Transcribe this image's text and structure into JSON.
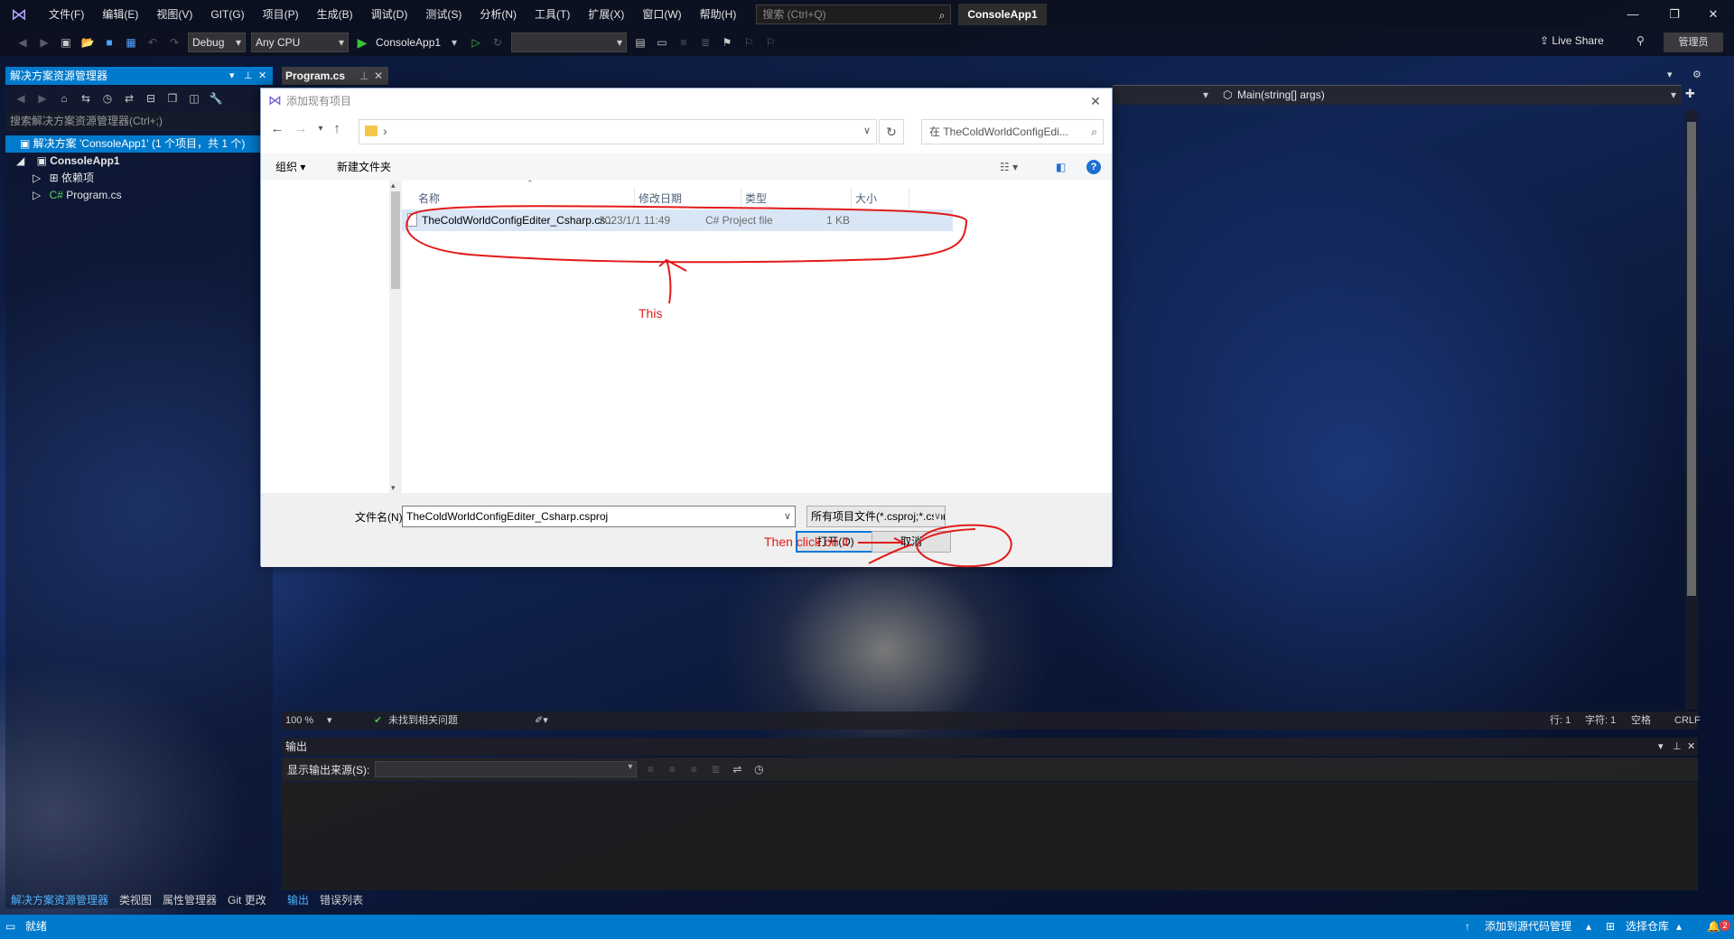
{
  "menubar": {
    "items": [
      "文件(F)",
      "编辑(E)",
      "视图(V)",
      "GIT(G)",
      "项目(P)",
      "生成(B)",
      "调试(D)",
      "测试(S)",
      "分析(N)",
      "工具(T)",
      "扩展(X)",
      "窗口(W)",
      "帮助(H)"
    ],
    "search_placeholder": "搜索 (Ctrl+Q)",
    "solution_name": "ConsoleApp1"
  },
  "toolbar": {
    "config": "Debug",
    "platform": "Any CPU",
    "start_project": "ConsoleApp1",
    "live_share": "Live Share",
    "admin": "管理员"
  },
  "solution_explorer": {
    "title": "解决方案资源管理器",
    "search_placeholder": "搜索解决方案资源管理器(Ctrl+;)",
    "tree": [
      {
        "label": "解决方案 'ConsoleApp1' (1 个项目，共 1 个)",
        "icon": "solution-icon"
      },
      {
        "label": "ConsoleApp1",
        "icon": "project-icon"
      },
      {
        "label": "依赖项",
        "icon": "dependencies-icon"
      },
      {
        "label": "Program.cs",
        "icon": "csharp-file-icon"
      }
    ],
    "bottom_tabs": [
      "解决方案资源管理器",
      "类视图",
      "属性管理器",
      "Git 更改"
    ]
  },
  "editor": {
    "tab": "Program.cs",
    "nav_member": "Main(string[] args)",
    "zoom": "100 %",
    "issues": "未找到相关问题",
    "line": "行: 1",
    "col": "字符: 1",
    "whitespace": "空格",
    "eol": "CRLF"
  },
  "output": {
    "title": "输出",
    "source_label": "显示输出来源(S):",
    "bottom_tabs": [
      "输出",
      "错误列表"
    ]
  },
  "statusbar": {
    "ready": "就绪",
    "add_source": "添加到源代码管理",
    "select_repo": "选择仓库",
    "notifications": "2"
  },
  "dialog": {
    "title": "添加现有项目",
    "search_placeholder": "在 TheColdWorldConfigEdi...",
    "organize": "组织",
    "new_folder": "新建文件夹",
    "columns": [
      "名称",
      "修改日期",
      "类型",
      "大小"
    ],
    "files": [
      {
        "name": "TheColdWorldConfigEditer_Csharp.cs...",
        "date": "2023/1/1 11:49",
        "type": "C# Project file",
        "size": "1 KB"
      }
    ],
    "filename_label": "文件名(N):",
    "filename_value": "TheColdWorldConfigEditer_Csharp.csproj",
    "filetype": "所有项目文件(*.csproj;*.cspro",
    "open_button": "打开(O)",
    "cancel_button": "取消"
  },
  "annotations": {
    "this": "This",
    "then": "Then click on it",
    "color": "#e21b1b"
  }
}
